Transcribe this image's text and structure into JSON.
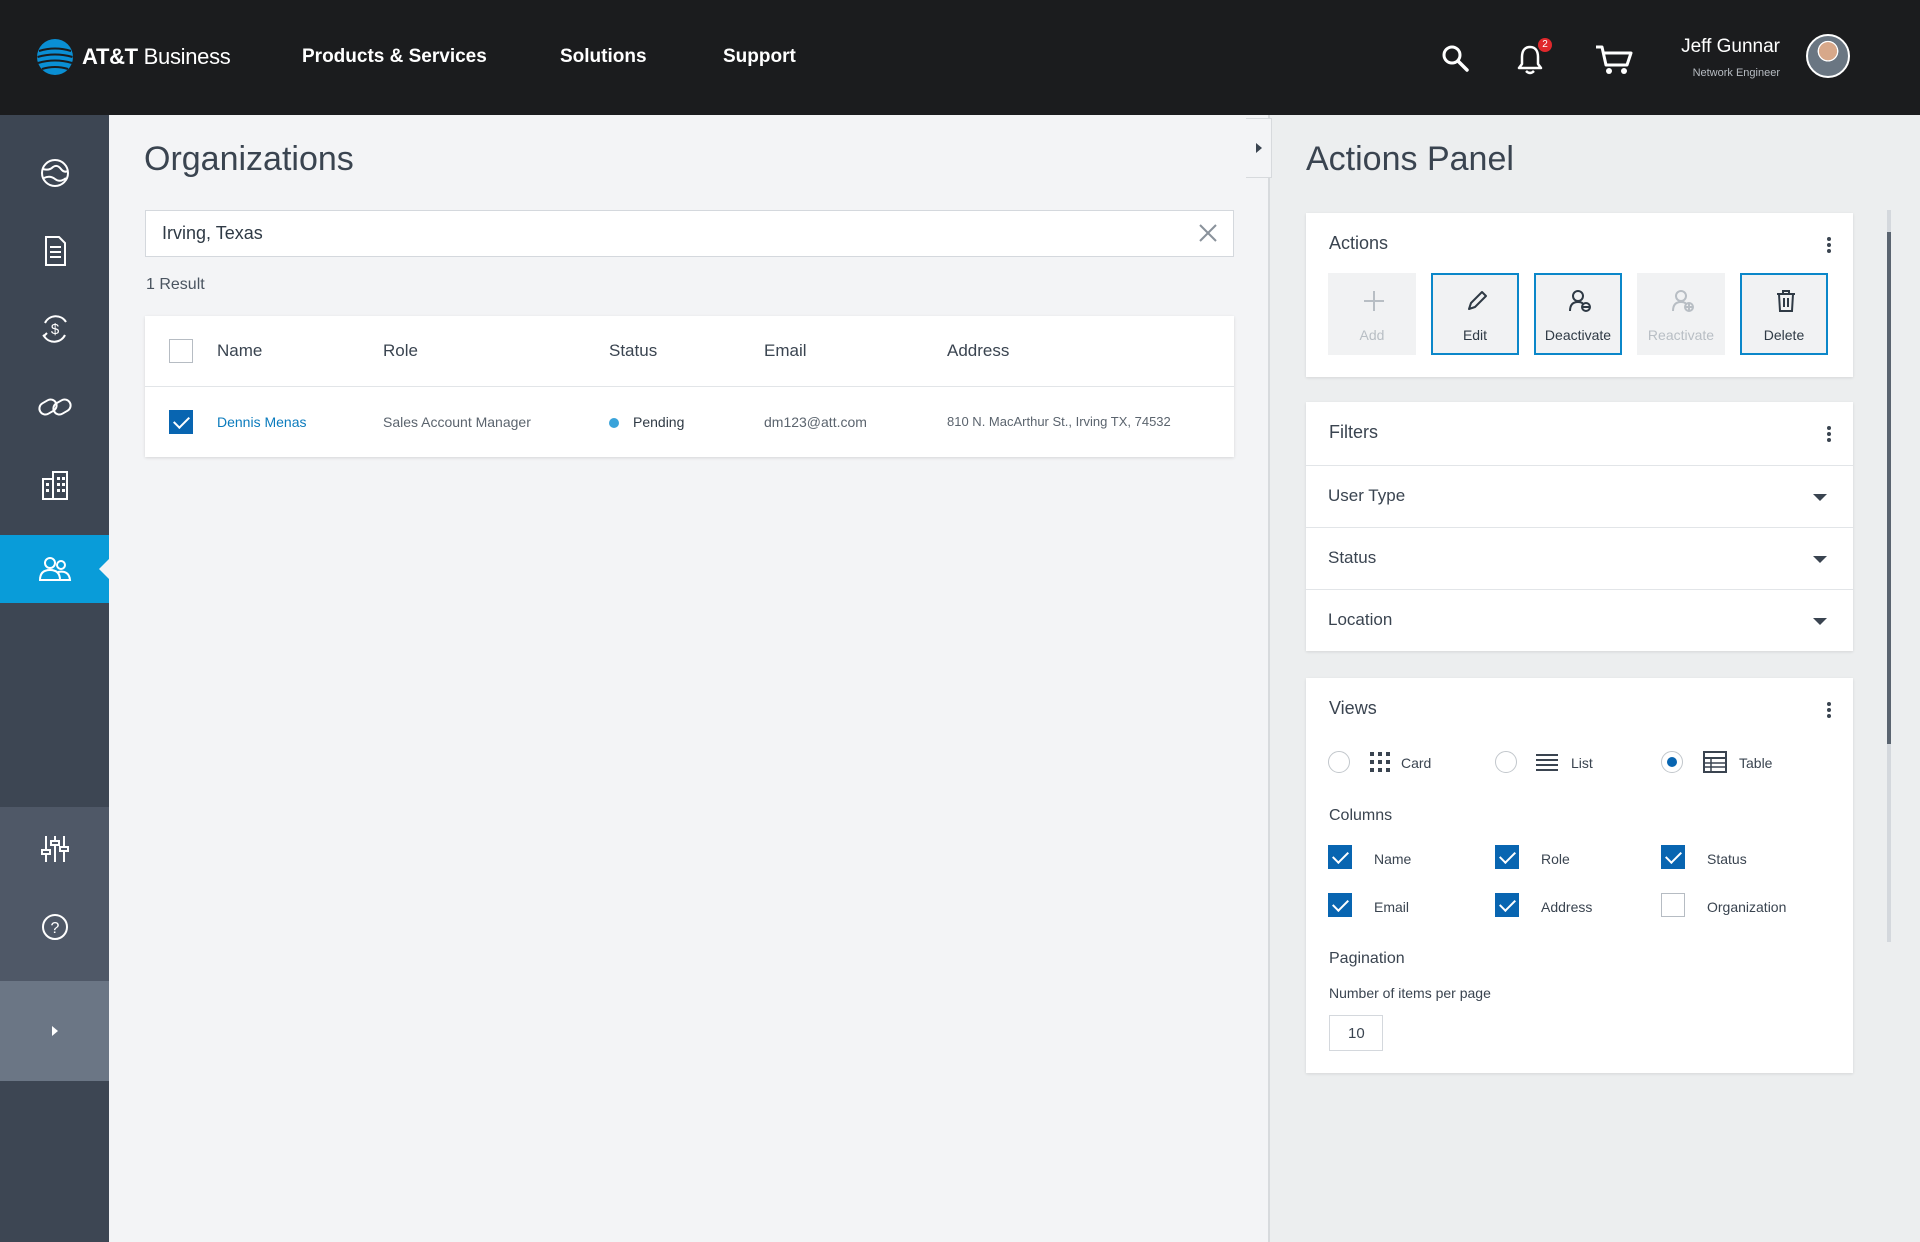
{
  "header": {
    "brand": "AT&T",
    "brand_suffix": "Business",
    "nav": [
      "Products & Services",
      "Solutions",
      "Support"
    ],
    "notification_count": "2",
    "user_name": "Jeff Gunnar",
    "user_title": "Network Engineer"
  },
  "sidebar": {
    "items": [
      "globe-icon",
      "document-icon",
      "billing-icon",
      "link-icon",
      "building-icon",
      "users-icon"
    ],
    "active_item": "users-icon",
    "bottom_items": [
      "sliders-icon",
      "help-icon"
    ]
  },
  "main": {
    "title": "Organizations",
    "search_value": "Irving, Texas",
    "result_count": "1 Result",
    "table": {
      "columns": [
        "Name",
        "Role",
        "Status",
        "Email",
        "Address"
      ],
      "rows": [
        {
          "selected": true,
          "name": "Dennis Menas",
          "role": "Sales Account Manager",
          "status": "Pending",
          "email": "dm123@att.com",
          "address": "810 N. MacArthur St., Irving TX, 74532"
        }
      ]
    }
  },
  "panel": {
    "title": "Actions Panel",
    "actions": {
      "title": "Actions",
      "buttons": [
        {
          "label": "Add",
          "enabled": false
        },
        {
          "label": "Edit",
          "enabled": true
        },
        {
          "label": "Deactivate",
          "enabled": true
        },
        {
          "label": "Reactivate",
          "enabled": false
        },
        {
          "label": "Delete",
          "enabled": true
        }
      ]
    },
    "filters": {
      "title": "Filters",
      "items": [
        "User Type",
        "Status",
        "Location"
      ]
    },
    "views": {
      "title": "Views",
      "options": [
        "Card",
        "List",
        "Table"
      ],
      "selected": "Table",
      "columns_title": "Columns",
      "columns": [
        {
          "label": "Name",
          "checked": true
        },
        {
          "label": "Role",
          "checked": true
        },
        {
          "label": "Status",
          "checked": true
        },
        {
          "label": "Email",
          "checked": true
        },
        {
          "label": "Address",
          "checked": true
        },
        {
          "label": "Organization",
          "checked": false
        }
      ],
      "pagination_title": "Pagination",
      "per_page_label": "Number of items per page",
      "per_page_value": "10"
    }
  },
  "colors": {
    "topbar": "#1b1c1e",
    "sidebar": "#3d4653",
    "accent": "#099cd9",
    "checkbox": "#0865b1",
    "link": "#0b7bbd"
  }
}
